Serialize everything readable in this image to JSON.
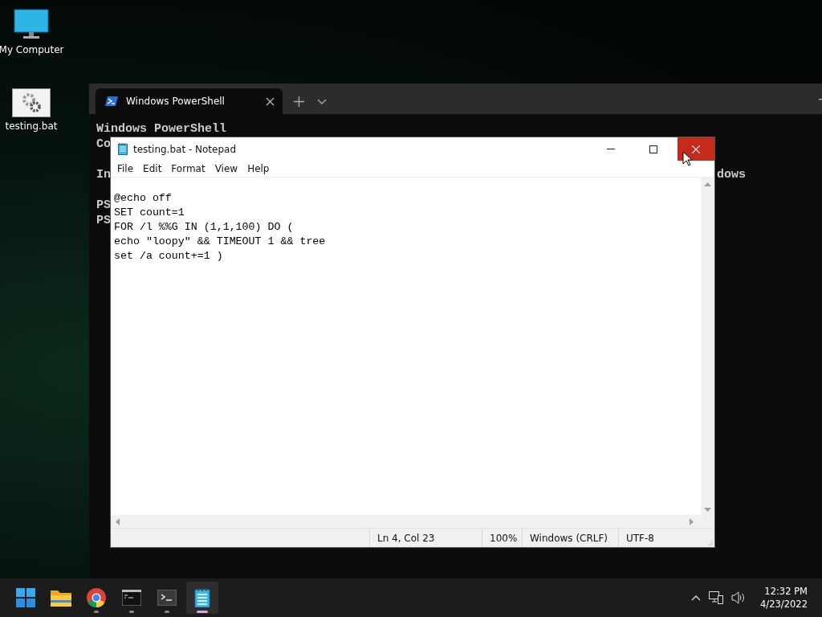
{
  "desktop_icons": [
    {
      "kind": "computer",
      "label": "My Computer"
    },
    {
      "kind": "batch-file",
      "label": "testing.bat"
    }
  ],
  "powershell": {
    "tab": {
      "title": "Windows PowerShell",
      "selected": true
    },
    "console_lines": [
      {
        "text": "Windows PowerShell"
      },
      {
        "text": "Co"
      },
      {
        "text": "In",
        "tail": "dows"
      },
      {
        "text": "PS"
      },
      {
        "text": "PS"
      }
    ]
  },
  "notepad": {
    "title": "testing.bat - Notepad",
    "close_hovered": true,
    "menu": [
      "File",
      "Edit",
      "Format",
      "View",
      "Help"
    ],
    "lines": [
      "@echo off",
      "SET count=1",
      "FOR /l %%G IN (1,1,100) DO (",
      "echo \"loopy\" && TIMEOUT 1 && tree",
      "set /a count+=1 )"
    ],
    "status_bar": {
      "position": "Ln 4, Col 23",
      "zoom": "100%",
      "line_ending": "Windows (CRLF)",
      "encoding": "UTF-8"
    }
  },
  "taskbar": {
    "apps": [
      {
        "kind": "start",
        "running": false,
        "selected": false
      },
      {
        "kind": "folder",
        "running": false,
        "selected": false
      },
      {
        "kind": "browser",
        "running": true,
        "selected": false
      },
      {
        "kind": "cmd",
        "running": true,
        "selected": false
      },
      {
        "kind": "terminal",
        "running": true,
        "selected": false
      },
      {
        "kind": "notepad",
        "running": true,
        "selected": true
      }
    ],
    "time": "12:32 PM",
    "date": "4/23/2022"
  }
}
